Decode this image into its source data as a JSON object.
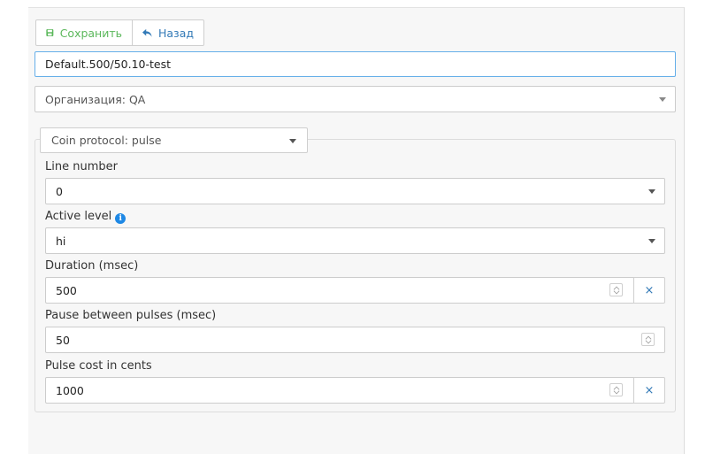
{
  "toolbar": {
    "save_label": "Сохранить",
    "back_label": "Назад"
  },
  "name_input": {
    "value": "Default.500/50.10-test"
  },
  "organization_select": {
    "value": "Организация: QA"
  },
  "coin_protocol_select": {
    "value": "Coin protocol: pulse"
  },
  "fields": {
    "line_number": {
      "label": "Line number",
      "value": "0"
    },
    "active_level": {
      "label": "Active level",
      "value": "hi",
      "info_icon": "info-icon"
    },
    "duration": {
      "label": "Duration (msec)",
      "value": "500",
      "clear": "×"
    },
    "pause": {
      "label": "Pause between pulses (msec)",
      "value": "50"
    },
    "pulse_cost": {
      "label": "Pulse cost in cents",
      "value": "1000",
      "clear": "×"
    }
  },
  "colors": {
    "save": "#5cb85c",
    "link": "#337ab7",
    "info": "#1e88e5",
    "focus_border": "#66afe9"
  }
}
